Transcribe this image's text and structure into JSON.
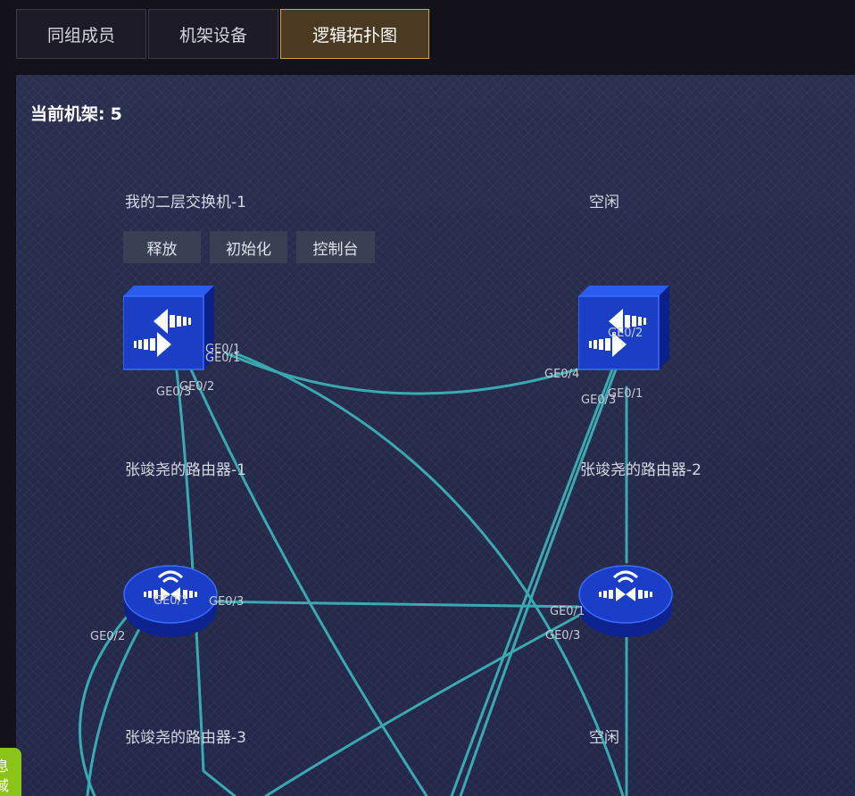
{
  "tabs": [
    {
      "label": "同组成员",
      "active": false
    },
    {
      "label": "机架设备",
      "active": false
    },
    {
      "label": "逻辑拓扑图",
      "active": true
    }
  ],
  "rack": {
    "label": "当前机架:",
    "number": "5"
  },
  "devices": {
    "switch1": {
      "name": "我的二层交换机-1",
      "icon": "switch-icon"
    },
    "idle1": {
      "name": "空闲"
    },
    "router1": {
      "name": "张竣尧的路由器-1",
      "icon": "router-icon"
    },
    "router2": {
      "name": "张竣尧的路由器-2",
      "icon": "router-icon"
    },
    "router3": {
      "name": "张竣尧的路由器-3"
    },
    "idle2": {
      "name": "空闲"
    }
  },
  "switch_buttons": {
    "release": "释放",
    "init": "初始化",
    "console": "控制台"
  },
  "ports": {
    "p1": "GE0/1",
    "p2": "GE0/1",
    "p3": "GE0/2",
    "p4": "GE0/3",
    "p5": "GE0/2",
    "p6": "GE0/4",
    "p7": "GE0/3",
    "p8": "GE0/1",
    "p9": "GE0/1",
    "p10": "GE0/3",
    "p11": "GE0/2",
    "p12": "GE0/1",
    "p13": "GE0/3"
  },
  "side_widget": {
    "text": "息 域"
  },
  "colors": {
    "link": "#3aa9b0",
    "active_tab_border": "#d3a24f",
    "device_blue": "#1740c8"
  }
}
